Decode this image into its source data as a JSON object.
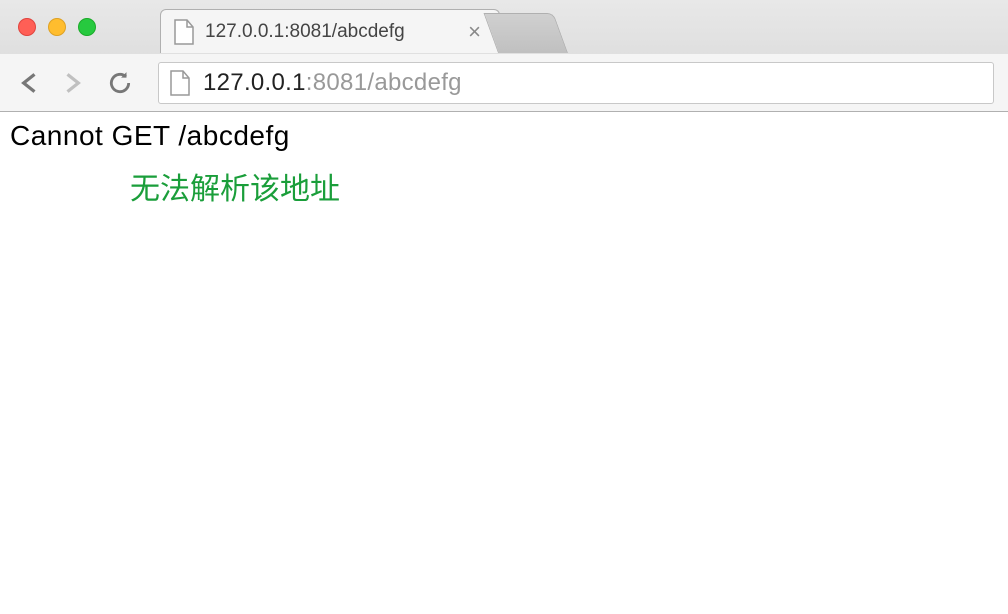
{
  "window": {
    "traffic_lights": [
      "red",
      "yellow",
      "green"
    ]
  },
  "tab": {
    "title": "127.0.0.1:8081/abcdefg"
  },
  "address_bar": {
    "host": "127.0.0.1",
    "port_path": ":8081/abcdefg"
  },
  "page": {
    "error_message": "Cannot GET /abcdefg",
    "annotation": "无法解析该地址"
  }
}
